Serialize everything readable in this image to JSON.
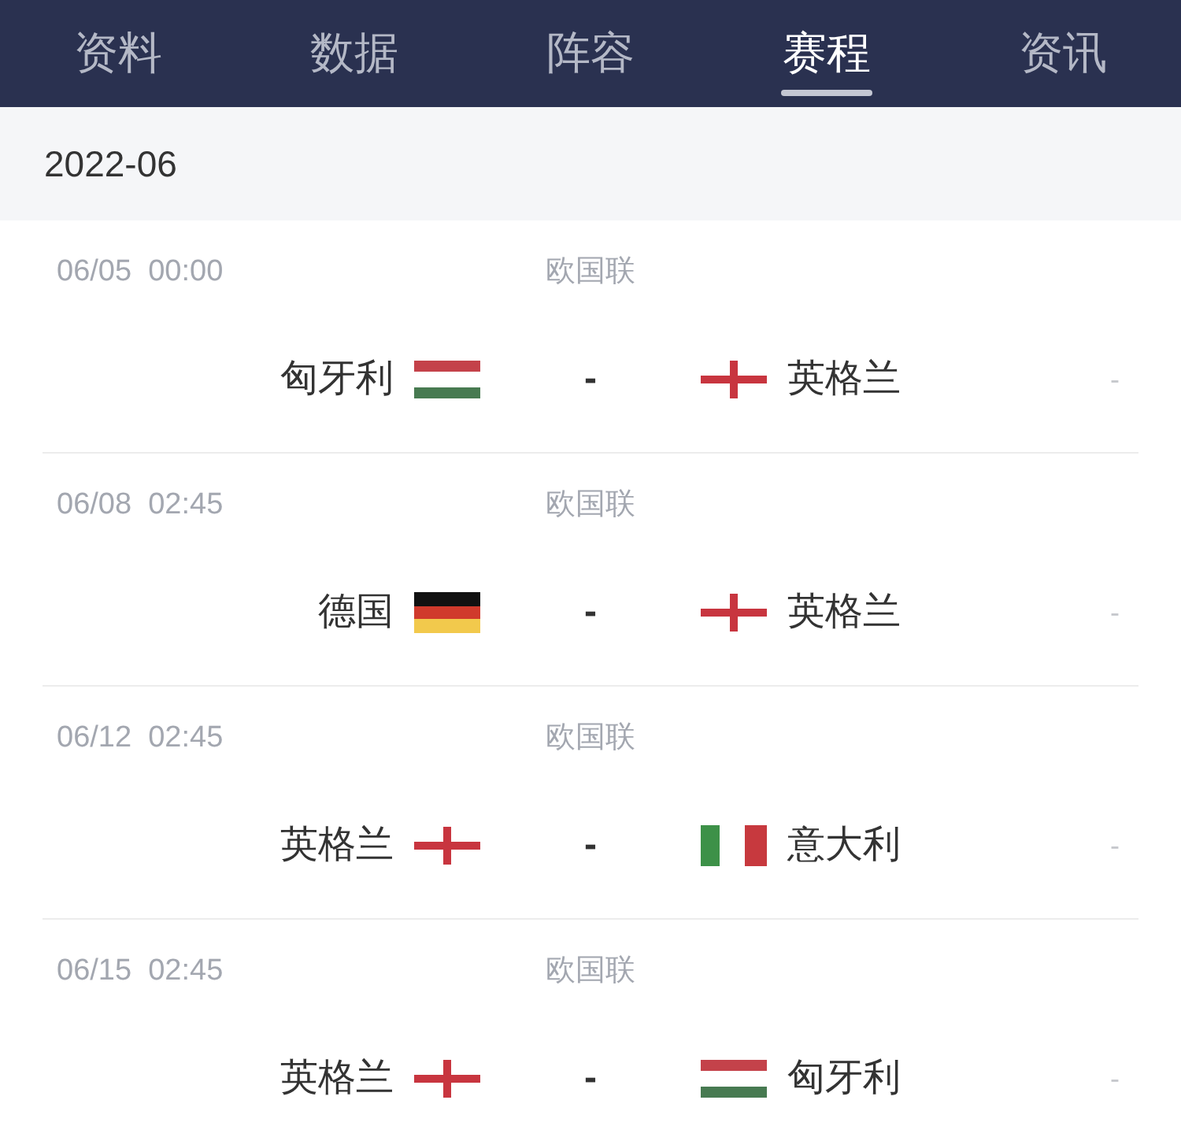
{
  "tabs": [
    {
      "label": "资料",
      "selected": false
    },
    {
      "label": "数据",
      "selected": false
    },
    {
      "label": "阵容",
      "selected": false
    },
    {
      "label": "赛程",
      "selected": true
    },
    {
      "label": "资讯",
      "selected": false
    }
  ],
  "month": "2022-06",
  "matches": [
    {
      "datetime": "06/05  00:00",
      "league": "欧国联",
      "home": {
        "name": "匈牙利",
        "flag": {
          "kind": "hungary"
        }
      },
      "score": "-",
      "away": {
        "name": "英格兰",
        "flag": {
          "kind": "england"
        }
      },
      "trailing_mark": "-"
    },
    {
      "datetime": "06/08  02:45",
      "league": "欧国联",
      "home": {
        "name": "德国",
        "flag": {
          "kind": "germany"
        }
      },
      "score": "-",
      "away": {
        "name": "英格兰",
        "flag": {
          "kind": "england"
        }
      },
      "trailing_mark": "-"
    },
    {
      "datetime": "06/12  02:45",
      "league": "欧国联",
      "home": {
        "name": "英格兰",
        "flag": {
          "kind": "england"
        }
      },
      "score": "-",
      "away": {
        "name": "意大利",
        "flag": {
          "kind": "italy"
        }
      },
      "trailing_mark": "-"
    },
    {
      "datetime": "06/15  02:45",
      "league": "欧国联",
      "home": {
        "name": "英格兰",
        "flag": {
          "kind": "england"
        }
      },
      "score": "-",
      "away": {
        "name": "匈牙利",
        "flag": {
          "kind": "hungary"
        }
      },
      "trailing_mark": "-"
    }
  ]
}
